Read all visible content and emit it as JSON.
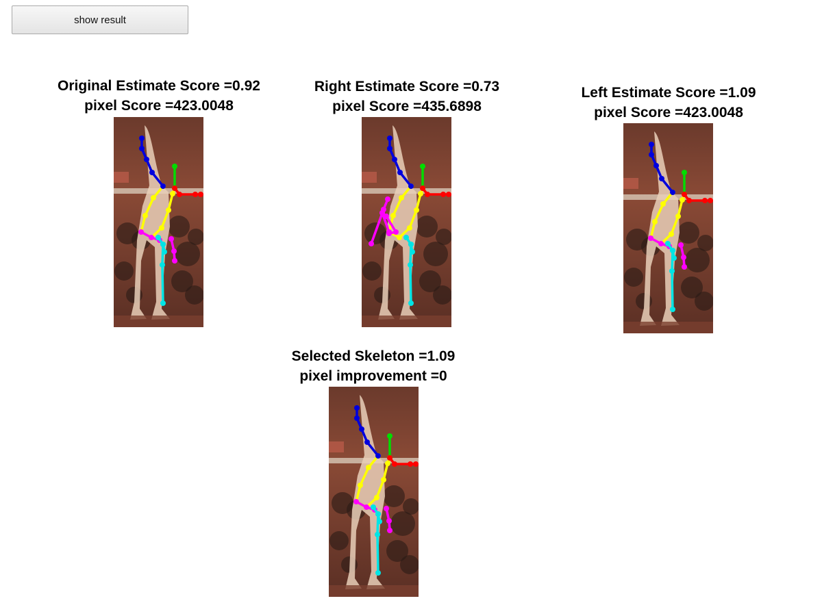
{
  "toolbar": {
    "show_result_label": "show result"
  },
  "panels": [
    {
      "id": "original",
      "line1": "Original Estimate Score =0.92",
      "line2": "pixel Score =423.0048"
    },
    {
      "id": "right",
      "line1": "Right Estimate Score =0.73",
      "line2": "pixel Score =435.6898"
    },
    {
      "id": "left",
      "line1": "Left Estimate Score =1.09",
      "line2": "pixel Score =423.0048"
    },
    {
      "id": "selected",
      "line1": "Selected Skeleton =1.09",
      "line2": "pixel improvement =0"
    }
  ],
  "skeleton_colors": {
    "head_arm": "#0000dd",
    "neck": "#00dd00",
    "right_arm": "#ff0000",
    "torso": "#ffff00",
    "left_arm": "#ff00ff",
    "leg": "#00e5e5"
  }
}
